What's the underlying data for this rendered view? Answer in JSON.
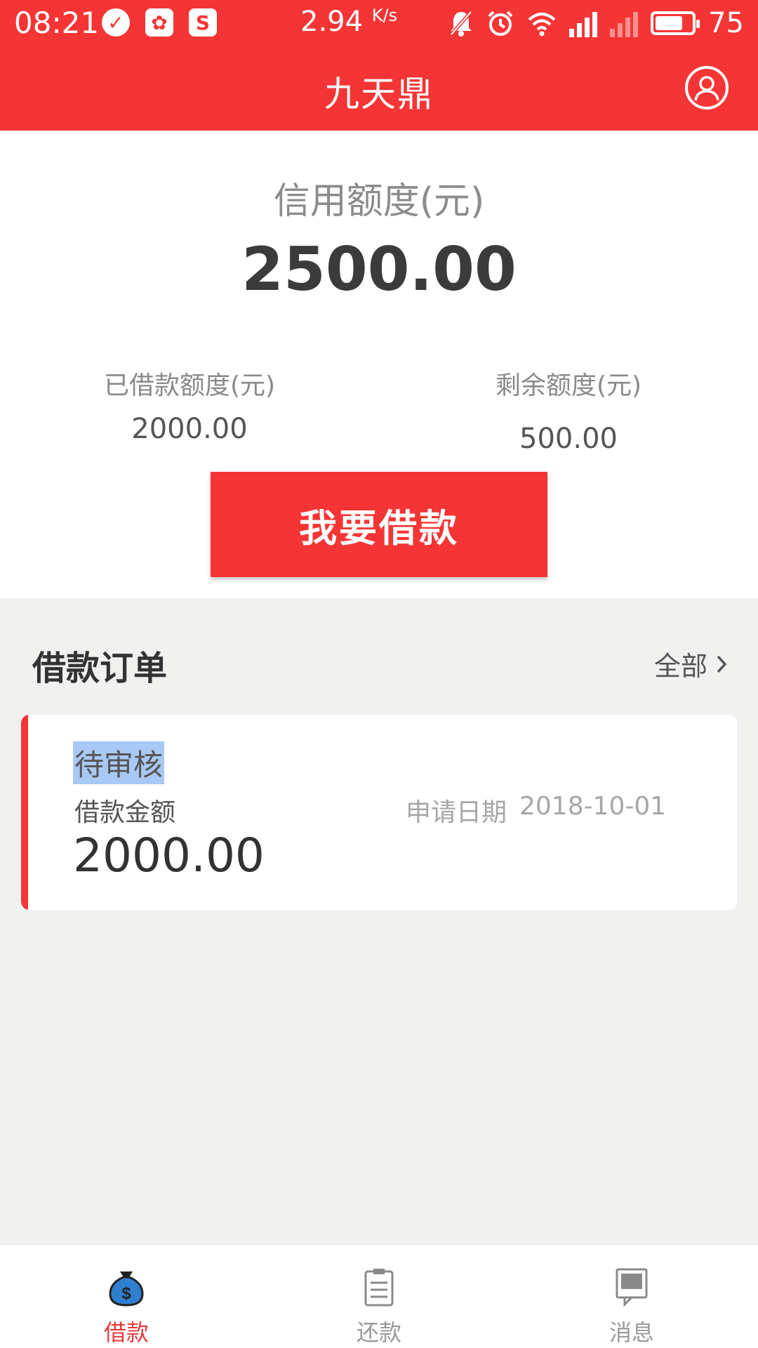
{
  "status_bar": {
    "time": "08:21",
    "speed": "2.94",
    "speed_unit": "K/s",
    "battery": "75",
    "battery_level": 0.75,
    "icons": [
      "check-circle-icon",
      "app-notify-icon",
      "s-app-icon",
      "mute-bell-icon",
      "alarm-icon",
      "wifi-icon",
      "signal-4g-icon",
      "signal-icon",
      "battery-icon"
    ]
  },
  "header": {
    "title": "九天鼎",
    "profile_icon": "user-avatar-icon"
  },
  "credit": {
    "label": "信用额度(元)",
    "value": "2500.00",
    "borrowed_label": "已借款额度(元)",
    "borrowed_value": "2000.00",
    "remaining_label": "剩余额度(元)",
    "remaining_value": "500.00",
    "borrow_button": "我要借款"
  },
  "orders": {
    "title": "借款订单",
    "all_link": "全部",
    "items": [
      {
        "status": "待审核",
        "amount_label": "借款金额",
        "amount": "2000.00",
        "date_label": "申请日期",
        "date": "2018-10-01"
      }
    ]
  },
  "tabs": [
    {
      "label": "借款",
      "icon": "money-bag-icon",
      "active": true
    },
    {
      "label": "还款",
      "icon": "clipboard-icon",
      "active": false
    },
    {
      "label": "消息",
      "icon": "message-icon",
      "active": false
    }
  ],
  "colors": {
    "primary": "#f53535",
    "background": "#f1f1ef",
    "status_highlight": "#a9c9f5",
    "tab_active": "#e53b3b",
    "tab_icon_blue": "#2f7fd0"
  }
}
